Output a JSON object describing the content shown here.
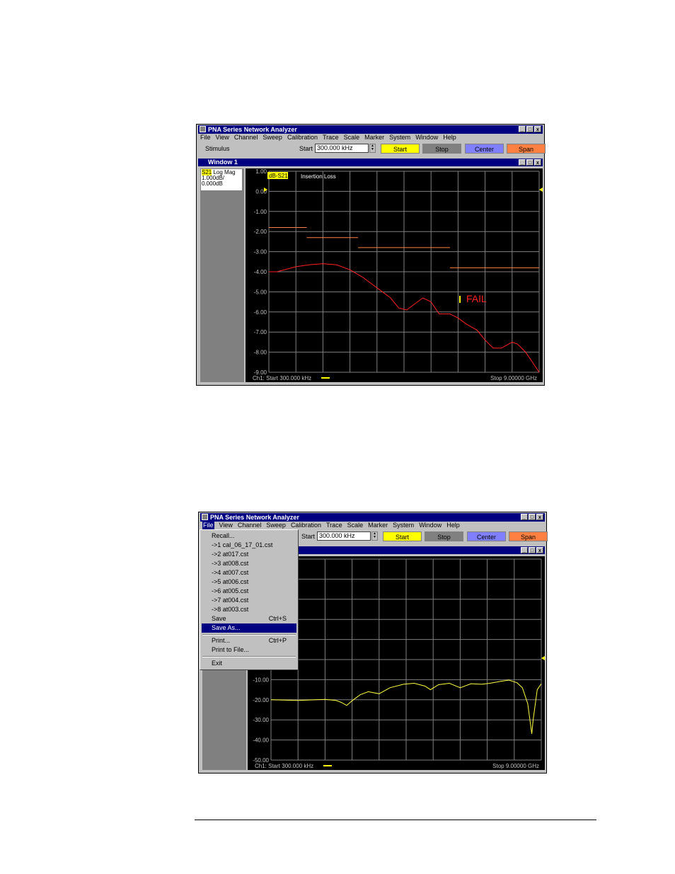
{
  "app_title": "PNA Series Network Analyzer",
  "window_buttons": [
    "_",
    "□",
    "x"
  ],
  "menu": [
    "File",
    "View",
    "Channel",
    "Sweep",
    "Calibration",
    "Trace",
    "Scale",
    "Marker",
    "System",
    "Window",
    "Help"
  ],
  "toolbar": {
    "stimulus_label": "Stimulus",
    "start_label": "Start",
    "start_value": "300.000 kHz",
    "buttons": {
      "start": "Start",
      "stop": "Stop",
      "center": "Center",
      "span": "Span"
    },
    "button_colors": {
      "start": "#ffff00",
      "stop": "#808080",
      "center": "#8080ff",
      "span": "#ff8040"
    }
  },
  "screen1": {
    "window_title": "Window 1",
    "measurement": {
      "param": "S21",
      "format": "Log Mag",
      "scale": "1.000dB/",
      "ref": "0.000dB"
    },
    "trace_label": "dB-S21",
    "title_text": "Insertion Loss",
    "fail_text": "FAIL",
    "status_start": "Ch1: Start  300.000 kHz",
    "status_stop": "Stop  9.00000 GHz",
    "y_ticks": [
      "1.00",
      "0.00",
      "-1.00",
      "-2.00",
      "-3.00",
      "-4.00",
      "-5.00",
      "-6.00",
      "-7.00",
      "-8.00",
      "-9.00"
    ],
    "limit_segments": [
      [
        0,
        1.4,
        -1.8
      ],
      [
        1.4,
        3.3,
        -2.3
      ],
      [
        3.3,
        6.7,
        -2.8
      ],
      [
        6.7,
        10,
        -3.8
      ]
    ],
    "trace": [
      [
        0,
        -4.0
      ],
      [
        0.3,
        -4.0
      ],
      [
        1.0,
        -3.75
      ],
      [
        1.5,
        -3.65
      ],
      [
        2.0,
        -3.6
      ],
      [
        2.5,
        -3.65
      ],
      [
        3.0,
        -3.9
      ],
      [
        3.5,
        -4.3
      ],
      [
        4.0,
        -4.8
      ],
      [
        4.5,
        -5.3
      ],
      [
        4.8,
        -5.8
      ],
      [
        5.1,
        -5.9
      ],
      [
        5.4,
        -5.6
      ],
      [
        5.7,
        -5.3
      ],
      [
        6.0,
        -5.5
      ],
      [
        6.3,
        -6.1
      ],
      [
        6.7,
        -6.1
      ],
      [
        7.0,
        -6.3
      ],
      [
        7.3,
        -6.6
      ],
      [
        7.7,
        -6.9
      ],
      [
        8.0,
        -7.4
      ],
      [
        8.3,
        -7.8
      ],
      [
        8.6,
        -7.8
      ],
      [
        9.0,
        -7.5
      ],
      [
        9.2,
        -7.6
      ],
      [
        9.5,
        -8.0
      ],
      [
        9.8,
        -8.6
      ],
      [
        10.0,
        -9.0
      ]
    ]
  },
  "screen2": {
    "file_menu": [
      {
        "label": "Recall...",
        "shortcut": ""
      },
      {
        "label": "->1 cal_06_17_01.cst",
        "shortcut": ""
      },
      {
        "label": "->2 at017.cst",
        "shortcut": ""
      },
      {
        "label": "->3 at008.cst",
        "shortcut": ""
      },
      {
        "label": "->4 at007.cst",
        "shortcut": ""
      },
      {
        "label": "->5 at006.cst",
        "shortcut": ""
      },
      {
        "label": "->6 at005.cst",
        "shortcut": ""
      },
      {
        "label": "->7 at004.cst",
        "shortcut": ""
      },
      {
        "label": "->8 at003.cst",
        "shortcut": ""
      },
      {
        "label": "Save",
        "shortcut": "Ctrl+S"
      },
      {
        "label": "Save As...",
        "shortcut": ""
      },
      {
        "label": "Print...",
        "shortcut": "Ctrl+P"
      },
      {
        "label": "Print to File...",
        "shortcut": ""
      },
      {
        "label": "Exit",
        "shortcut": ""
      }
    ],
    "selected_item": "Save As...",
    "y_ticks": [
      "-10.00",
      "-20.00",
      "-30.00",
      "-40.00",
      "-50.00"
    ],
    "status_start": "Ch1: Start  300.000 kHz",
    "status_stop": "Stop  9.00000 GHz",
    "trace": [
      [
        0,
        -20
      ],
      [
        1.0,
        -20.3
      ],
      [
        2.0,
        -19.8
      ],
      [
        2.4,
        -20.3
      ],
      [
        2.6,
        -21.3
      ],
      [
        2.8,
        -22.8
      ],
      [
        3.0,
        -20.5
      ],
      [
        3.3,
        -17.5
      ],
      [
        3.6,
        -16
      ],
      [
        4.0,
        -17
      ],
      [
        4.4,
        -14
      ],
      [
        4.9,
        -12.3
      ],
      [
        5.3,
        -11.8
      ],
      [
        5.7,
        -13.2
      ],
      [
        5.9,
        -15
      ],
      [
        6.2,
        -12.5
      ],
      [
        6.6,
        -11.8
      ],
      [
        7.0,
        -14
      ],
      [
        7.4,
        -12
      ],
      [
        7.8,
        -12.3
      ],
      [
        8.1,
        -11.8
      ],
      [
        8.5,
        -10.8
      ],
      [
        8.8,
        -10.2
      ],
      [
        9.1,
        -11.5
      ],
      [
        9.3,
        -14
      ],
      [
        9.5,
        -22
      ],
      [
        9.6,
        -32
      ],
      [
        9.65,
        -37
      ],
      [
        9.7,
        -30
      ],
      [
        9.85,
        -15
      ],
      [
        10,
        -12
      ]
    ]
  }
}
